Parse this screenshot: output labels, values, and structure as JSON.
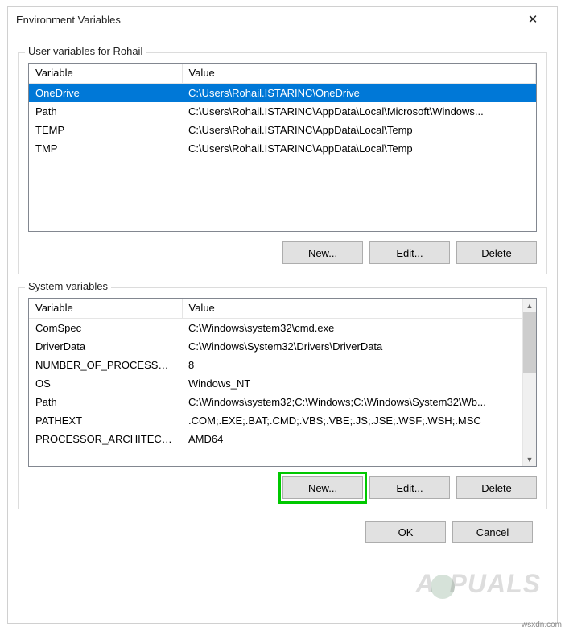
{
  "dialog": {
    "title": "Environment Variables",
    "close_icon": "✕"
  },
  "user_group": {
    "label": "User variables for Rohail",
    "header_variable": "Variable",
    "header_value": "Value",
    "rows": [
      {
        "var": "OneDrive",
        "val": "C:\\Users\\Rohail.ISTARINC\\OneDrive"
      },
      {
        "var": "Path",
        "val": "C:\\Users\\Rohail.ISTARINC\\AppData\\Local\\Microsoft\\Windows..."
      },
      {
        "var": "TEMP",
        "val": "C:\\Users\\Rohail.ISTARINC\\AppData\\Local\\Temp"
      },
      {
        "var": "TMP",
        "val": "C:\\Users\\Rohail.ISTARINC\\AppData\\Local\\Temp"
      }
    ],
    "selected": 0,
    "buttons": {
      "new": "New...",
      "edit": "Edit...",
      "delete": "Delete"
    }
  },
  "system_group": {
    "label": "System variables",
    "header_variable": "Variable",
    "header_value": "Value",
    "rows": [
      {
        "var": "ComSpec",
        "val": "C:\\Windows\\system32\\cmd.exe"
      },
      {
        "var": "DriverData",
        "val": "C:\\Windows\\System32\\Drivers\\DriverData"
      },
      {
        "var": "NUMBER_OF_PROCESSORS",
        "val": "8"
      },
      {
        "var": "OS",
        "val": "Windows_NT"
      },
      {
        "var": "Path",
        "val": "C:\\Windows\\system32;C:\\Windows;C:\\Windows\\System32\\Wb..."
      },
      {
        "var": "PATHEXT",
        "val": ".COM;.EXE;.BAT;.CMD;.VBS;.VBE;.JS;.JSE;.WSF;.WSH;.MSC"
      },
      {
        "var": "PROCESSOR_ARCHITECTU...",
        "val": "AMD64"
      }
    ],
    "buttons": {
      "new": "New...",
      "edit": "Edit...",
      "delete": "Delete"
    }
  },
  "footer": {
    "ok": "OK",
    "cancel": "Cancel"
  },
  "watermark": {
    "text_pre": "A",
    "text_post": "PUALS"
  },
  "credit": "wsxdn.com"
}
